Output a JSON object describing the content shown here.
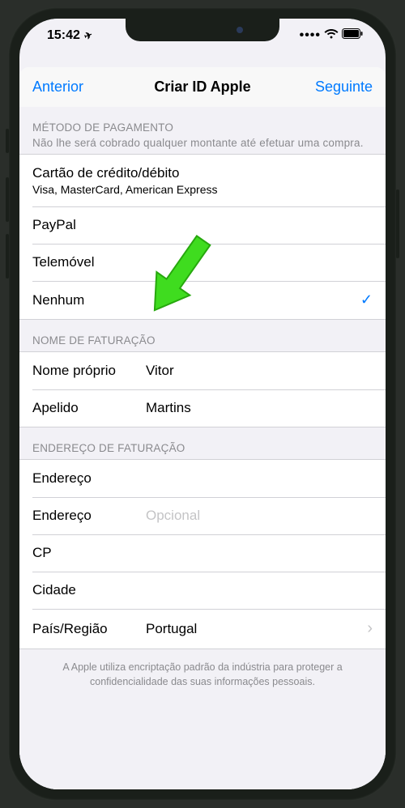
{
  "status": {
    "time": "15:42",
    "location_glyph": "➤"
  },
  "nav": {
    "back": "Anterior",
    "title": "Criar ID Apple",
    "next": "Seguinte"
  },
  "payment": {
    "header": "MÉTODO DE PAGAMENTO",
    "subheader": "Não lhe será cobrado qualquer montante até efetuar uma compra.",
    "options": {
      "card": {
        "title": "Cartão de crédito/débito",
        "sub": "Visa, MasterCard, American Express"
      },
      "paypal": "PayPal",
      "phone": "Telemóvel",
      "none": "Nenhum"
    }
  },
  "billing_name": {
    "header": "NOME DE FATURAÇÃO",
    "first_label": "Nome próprio",
    "first_value": "Vitor",
    "last_label": "Apelido",
    "last_value": "Martins"
  },
  "billing_address": {
    "header": "ENDEREÇO DE FATURAÇÃO",
    "address_label": "Endereço",
    "address_value": "",
    "address2_label": "Endereço",
    "address2_placeholder": "Opcional",
    "zip_label": "CP",
    "zip_value": "",
    "city_label": "Cidade",
    "city_value": "",
    "country_label": "País/Região",
    "country_value": "Portugal"
  },
  "footer": "A Apple utiliza encriptação padrão da indústria para proteger a confidencialidade das suas informações pessoais."
}
